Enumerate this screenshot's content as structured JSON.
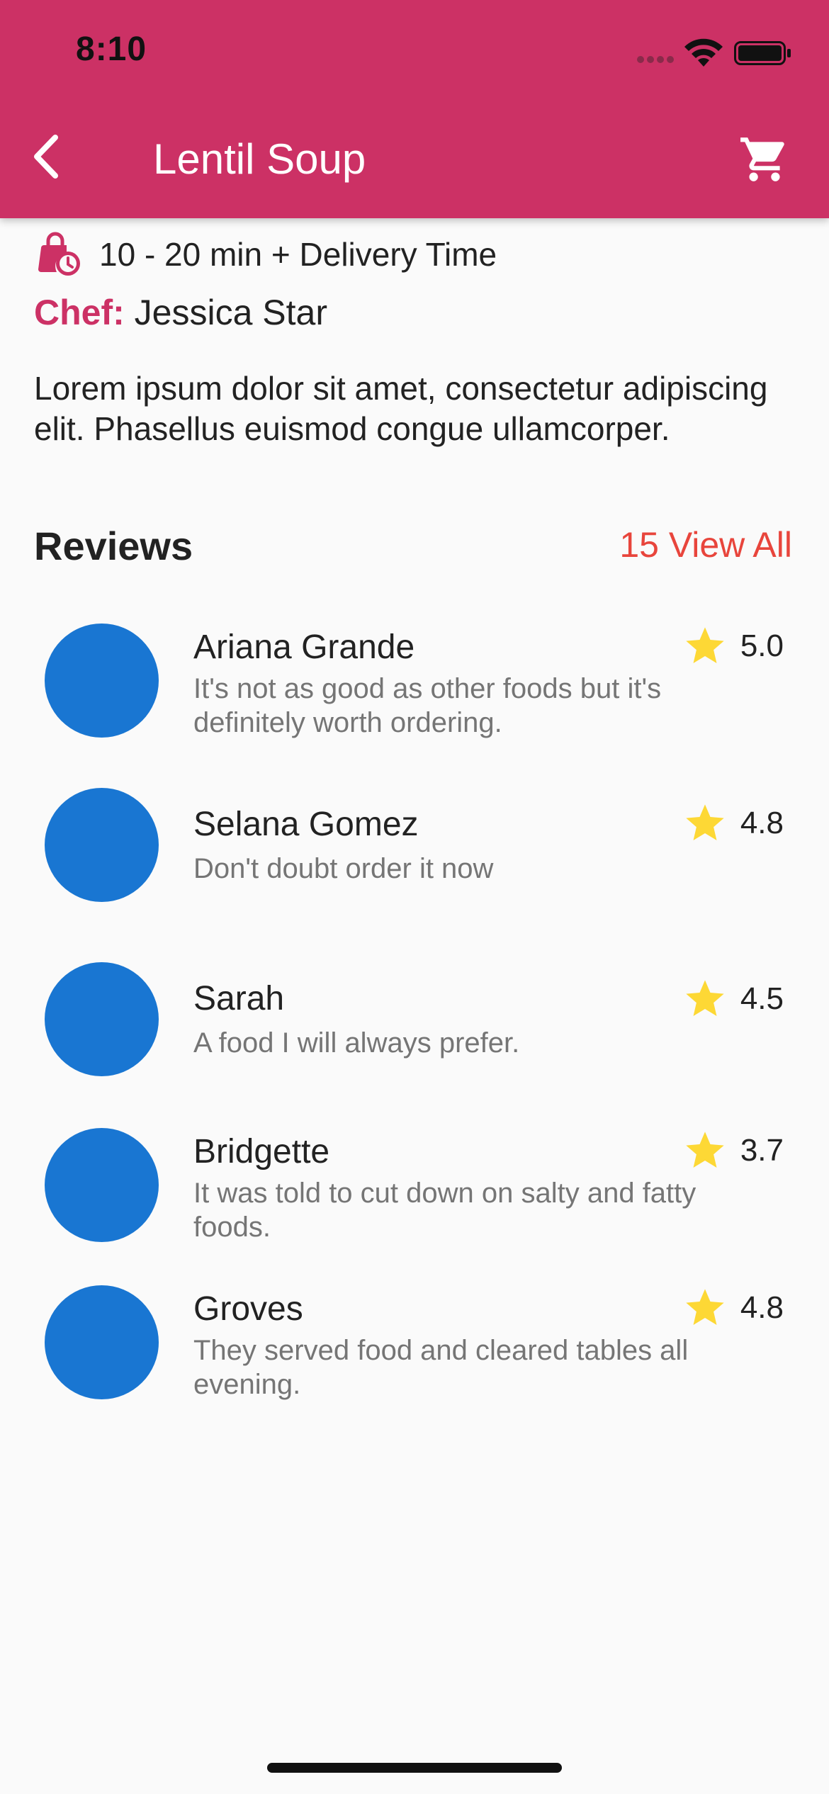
{
  "status_bar": {
    "time": "8:10"
  },
  "header": {
    "title": "Lentil Soup",
    "background_color": "#cc3165",
    "back_icon": "chevron-left-icon",
    "cart_icon": "shopping-cart-icon"
  },
  "info": {
    "delivery_icon": "shopping-bag-clock-icon",
    "delivery_text": "10 - 20 min + Delivery Time",
    "chef_label": "Chef:",
    "chef_name": "Jessica Star",
    "description": "Lorem ipsum dolor sit amet, consectetur adipiscing elit. Phasellus euismod congue ullamcorper."
  },
  "reviews": {
    "title": "Reviews",
    "view_all": "15 View All",
    "star_icon": "star-icon",
    "star_color": "#fdd835",
    "avatar_color": "#1976d2",
    "items": [
      {
        "name": "Ariana Grande",
        "rating": "5.0",
        "comment": "It's not as good as other foods but it's definitely worth ordering."
      },
      {
        "name": "Selana Gomez",
        "rating": "4.8",
        "comment": "Don't doubt order it now"
      },
      {
        "name": "Sarah",
        "rating": "4.5",
        "comment": "A food I will always prefer."
      },
      {
        "name": "Bridgette",
        "rating": "3.7",
        "comment": "It was told to cut down on salty and fatty foods."
      },
      {
        "name": "Groves",
        "rating": "4.8",
        "comment": "They served food and cleared tables all evening."
      }
    ]
  }
}
